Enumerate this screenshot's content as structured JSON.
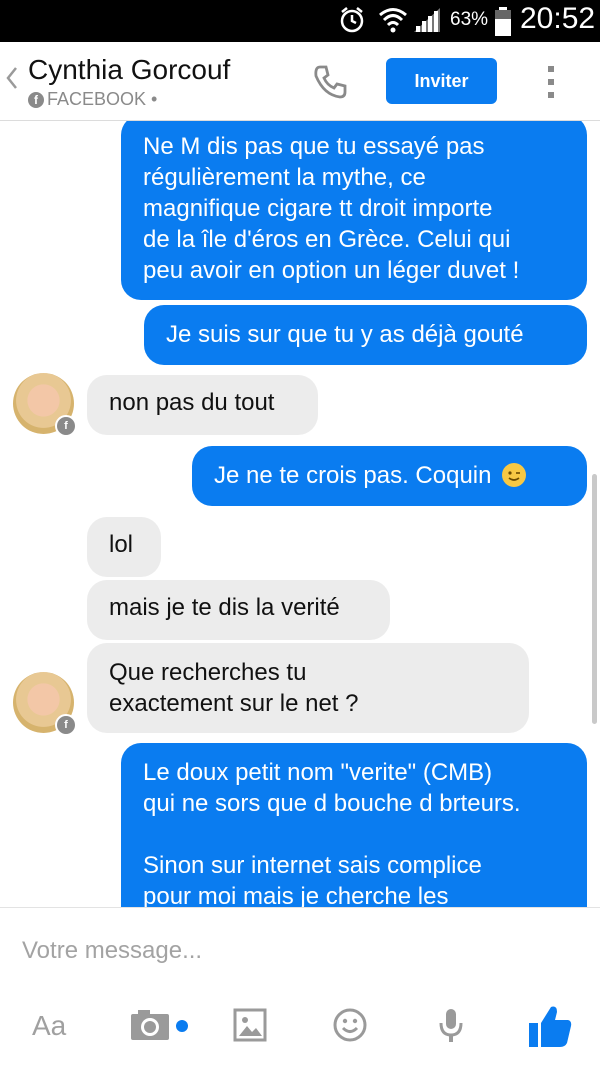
{
  "status_bar": {
    "battery_percent": "63%",
    "time": "20:52"
  },
  "header": {
    "contact_name": "Cynthia Gorcouf",
    "source": "FACEBOOK •",
    "invite_label": "Inviter"
  },
  "messages": [
    {
      "direction": "out",
      "lines": [
        "Ne M dis pas que tu essayé pas",
        "régulièrement la mythe, ce",
        "magnifique cigare tt droit importe",
        "de la île d'éros en Grèce.  Celui qui",
        "peu avoir en option un léger duvet !"
      ]
    },
    {
      "direction": "out",
      "lines": [
        "Je suis sur que tu y as déjà gouté"
      ]
    },
    {
      "direction": "in",
      "lines": [
        "non pas du tout"
      ]
    },
    {
      "direction": "out",
      "lines": [
        "Je ne te crois pas.  Coquin"
      ],
      "emoji": "wink-emoji"
    },
    {
      "direction": "in",
      "lines": [
        "lol"
      ]
    },
    {
      "direction": "in",
      "lines": [
        "mais je te dis la verité"
      ]
    },
    {
      "direction": "in",
      "lines": [
        "Que recherches tu",
        "exactement sur le net ?"
      ]
    },
    {
      "direction": "out",
      "lines": [
        "Le doux petit nom \"verite\" (CMB)",
        "qui ne sors que d bouche d brteurs.",
        "",
        "Sinon sur internet sais complice",
        "pour moi mais je cherche les"
      ]
    }
  ],
  "composer": {
    "placeholder": "Votre message...",
    "text_tool_label": "Aa"
  },
  "colors": {
    "accent": "#0a7cf0",
    "incoming_bubble": "#ececec"
  }
}
